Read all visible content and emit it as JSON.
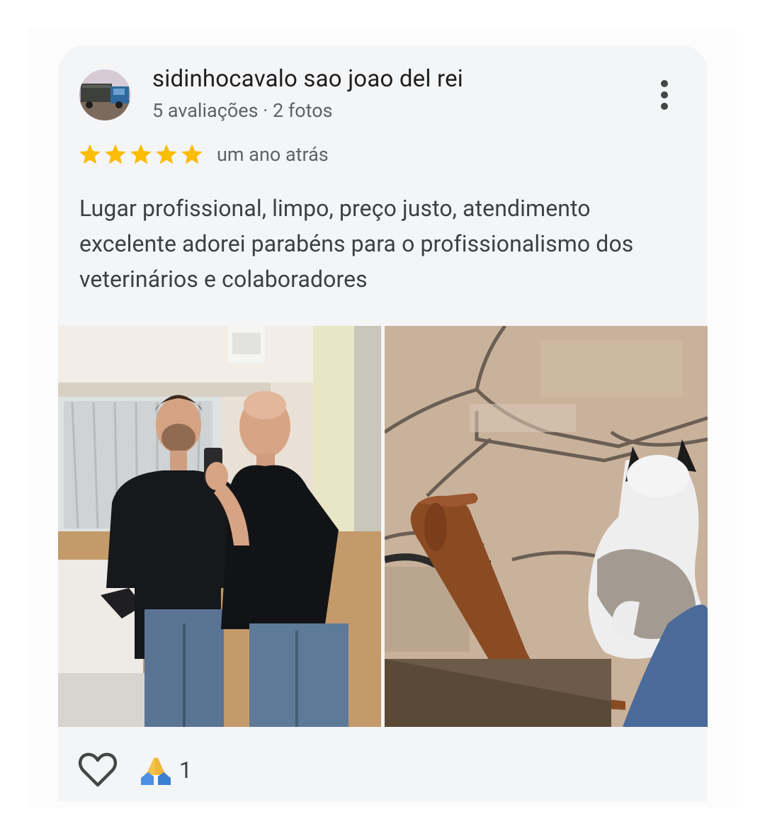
{
  "review": {
    "author_name": "sidinhocavalo sao joao del rei",
    "author_meta": "5 avaliações · 2 fotos",
    "rating": 5,
    "rating_max": 5,
    "time_ago": "um ano atrás",
    "text": "Lugar profissional, limpo, preço justo, atendimento excelente adorei parabéns para o profissionalismo dos veterinários e colaboradores",
    "reactions": {
      "emoji": "🙏",
      "count": "1"
    }
  },
  "icons": {
    "more": "more-vert-icon",
    "star": "star-icon",
    "like": "heart-outline-icon",
    "reaction": "folded-hands-icon"
  },
  "colors": {
    "star": "#fbbc04",
    "card_background": "#f4f5f7",
    "primary_text": "#1f1f1f",
    "secondary_text": "#5f6368"
  }
}
